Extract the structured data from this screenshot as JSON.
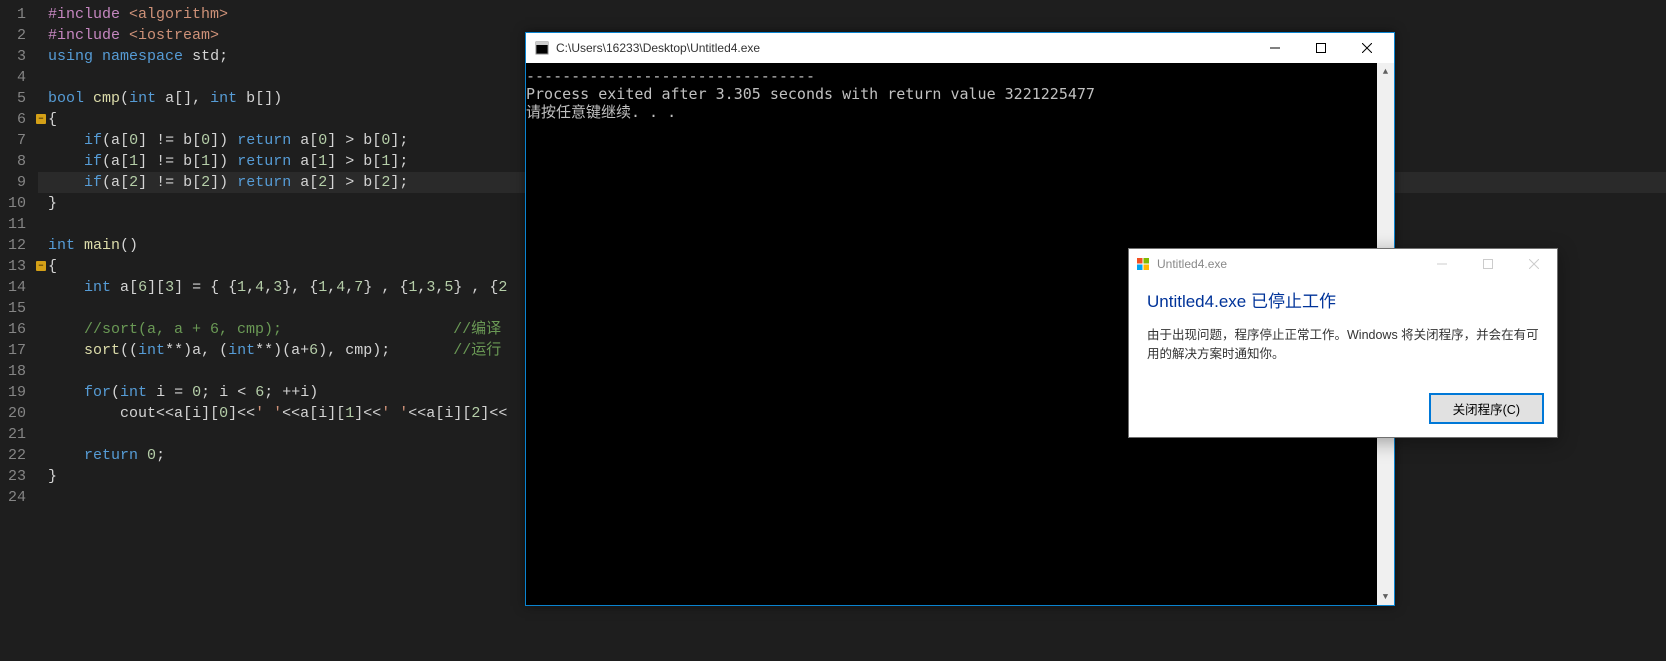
{
  "editor": {
    "lines": [
      {
        "n": 1,
        "html": "<span class='pp'>#include</span> <span class='str'>&lt;algorithm&gt;</span>"
      },
      {
        "n": 2,
        "html": "<span class='pp'>#include</span> <span class='str'>&lt;iostream&gt;</span>"
      },
      {
        "n": 3,
        "html": "<span class='kw'>using</span> <span class='kw'>namespace</span> <span class='id'>std</span><span class='op'>;</span>"
      },
      {
        "n": 4,
        "html": ""
      },
      {
        "n": 5,
        "html": "<span class='ty'>bool</span> <span class='fn'>cmp</span><span class='op'>(</span><span class='ty'>int</span> <span class='id'>a</span><span class='op'>[],</span> <span class='ty'>int</span> <span class='id'>b</span><span class='op'>[])</span>"
      },
      {
        "n": 6,
        "html": "<span class='op'>{</span>",
        "fold": true
      },
      {
        "n": 7,
        "html": "    <span class='kw'>if</span><span class='op'>(</span><span class='id'>a</span><span class='op'>[</span><span class='num'>0</span><span class='op'>] != </span><span class='id'>b</span><span class='op'>[</span><span class='num'>0</span><span class='op'>])</span> <span class='kw'>return</span> <span class='id'>a</span><span class='op'>[</span><span class='num'>0</span><span class='op'>] &gt; </span><span class='id'>b</span><span class='op'>[</span><span class='num'>0</span><span class='op'>];</span>"
      },
      {
        "n": 8,
        "html": "    <span class='kw'>if</span><span class='op'>(</span><span class='id'>a</span><span class='op'>[</span><span class='num'>1</span><span class='op'>] != </span><span class='id'>b</span><span class='op'>[</span><span class='num'>1</span><span class='op'>])</span> <span class='kw'>return</span> <span class='id'>a</span><span class='op'>[</span><span class='num'>1</span><span class='op'>] &gt; </span><span class='id'>b</span><span class='op'>[</span><span class='num'>1</span><span class='op'>];</span>"
      },
      {
        "n": 9,
        "html": "    <span class='kw'>if</span><span class='op'>(</span><span class='id'>a</span><span class='op'>[</span><span class='num'>2</span><span class='op'>] != </span><span class='id'>b</span><span class='op'>[</span><span class='num'>2</span><span class='op'>])</span> <span class='kw'>return</span> <span class='id'>a</span><span class='op'>[</span><span class='num'>2</span><span class='op'>] &gt; </span><span class='id'>b</span><span class='op'>[</span><span class='num'>2</span><span class='op'>];</span>",
        "hl": true
      },
      {
        "n": 10,
        "html": "<span class='op'>}</span>"
      },
      {
        "n": 11,
        "html": ""
      },
      {
        "n": 12,
        "html": "<span class='ty'>int</span> <span class='fn'>main</span><span class='op'>()</span>"
      },
      {
        "n": 13,
        "html": "<span class='op'>{</span>",
        "fold": true
      },
      {
        "n": 14,
        "html": "    <span class='ty'>int</span> <span class='id'>a</span><span class='op'>[</span><span class='num'>6</span><span class='op'>][</span><span class='num'>3</span><span class='op'>] = { {</span><span class='num'>1</span><span class='op'>,</span><span class='num'>4</span><span class='op'>,</span><span class='num'>3</span><span class='op'>}, {</span><span class='num'>1</span><span class='op'>,</span><span class='num'>4</span><span class='op'>,</span><span class='num'>7</span><span class='op'>} , {</span><span class='num'>1</span><span class='op'>,</span><span class='num'>3</span><span class='op'>,</span><span class='num'>5</span><span class='op'>} , {</span><span class='num'>2</span>"
      },
      {
        "n": 15,
        "html": ""
      },
      {
        "n": 16,
        "html": "    <span class='cm'>//sort(a, a + 6, cmp);                   //编译</span>"
      },
      {
        "n": 17,
        "html": "    <span class='fn'>sort</span><span class='op'>((</span><span class='ty'>int</span><span class='op'>**)</span><span class='id'>a</span><span class='op'>, (</span><span class='ty'>int</span><span class='op'>**)(</span><span class='id'>a</span><span class='op'>+</span><span class='num'>6</span><span class='op'>), </span><span class='id'>cmp</span><span class='op'>);       </span><span class='cm'>//运行</span>"
      },
      {
        "n": 18,
        "html": ""
      },
      {
        "n": 19,
        "html": "    <span class='kw'>for</span><span class='op'>(</span><span class='ty'>int</span> <span class='id'>i</span> <span class='op'>=</span> <span class='num'>0</span><span class='op'>;</span> <span class='id'>i</span> <span class='op'>&lt;</span> <span class='num'>6</span><span class='op'>; ++</span><span class='id'>i</span><span class='op'>)</span>"
      },
      {
        "n": 20,
        "html": "        <span class='id'>cout</span><span class='op'>&lt;&lt;</span><span class='id'>a</span><span class='op'>[</span><span class='id'>i</span><span class='op'>][</span><span class='num'>0</span><span class='op'>]&lt;&lt;</span><span class='str'>' '</span><span class='op'>&lt;&lt;</span><span class='id'>a</span><span class='op'>[</span><span class='id'>i</span><span class='op'>][</span><span class='num'>1</span><span class='op'>]&lt;&lt;</span><span class='str'>' '</span><span class='op'>&lt;&lt;</span><span class='id'>a</span><span class='op'>[</span><span class='id'>i</span><span class='op'>][</span><span class='num'>2</span><span class='op'>]&lt;&lt;</span>"
      },
      {
        "n": 21,
        "html": ""
      },
      {
        "n": 22,
        "html": "    <span class='kw'>return</span> <span class='num'>0</span><span class='op'>;</span>"
      },
      {
        "n": 23,
        "html": "<span class='op'>}</span>"
      },
      {
        "n": 24,
        "html": ""
      }
    ]
  },
  "console": {
    "title": "C:\\Users\\16233\\Desktop\\Untitled4.exe",
    "lines": [
      "--------------------------------",
      "Process exited after 3.305 seconds with return value 3221225477",
      "请按任意键继续. . ."
    ]
  },
  "dialog": {
    "title": "Untitled4.exe",
    "heading": "Untitled4.exe 已停止工作",
    "message": "由于出现问题，程序停止正常工作。Windows 将关闭程序，并会在有可用的解决方案时通知你。",
    "button": "关闭程序(C)"
  }
}
